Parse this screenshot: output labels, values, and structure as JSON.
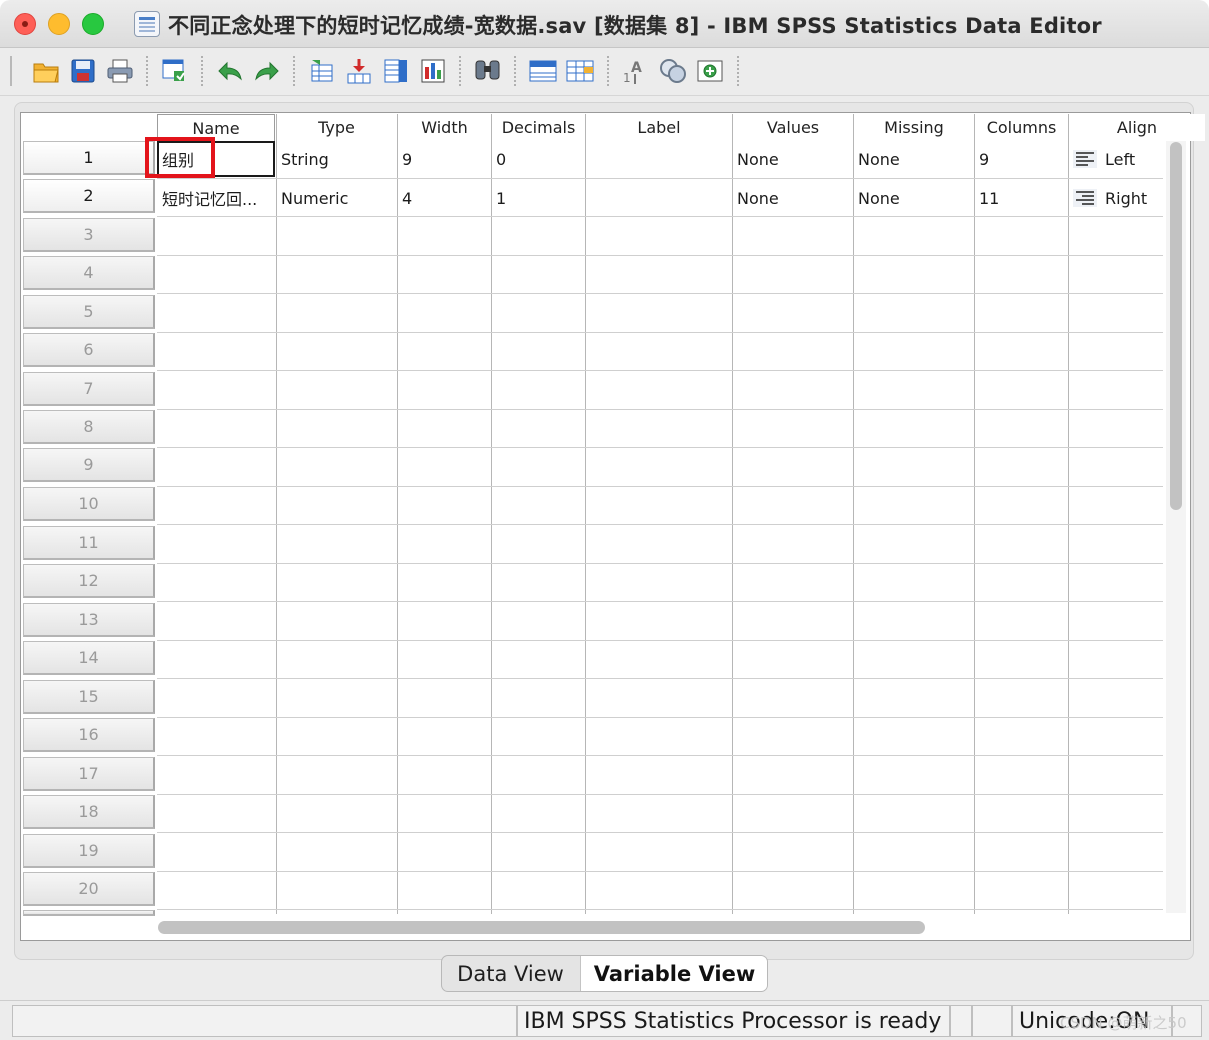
{
  "window": {
    "title": "不同正念处理下的短时记忆成绩-宽数据.sav [数据集 8] - IBM SPSS Statistics Data Editor"
  },
  "toolbar": {
    "buttons": [
      "open-icon",
      "save-icon",
      "print-icon",
      "dialog-recall-icon",
      "undo-icon",
      "redo-icon",
      "goto-case-icon",
      "goto-variable-icon",
      "variables-icon",
      "run-descriptives-icon",
      "find-icon",
      "insert-cases-icon",
      "insert-variable-icon",
      "value-labels-icon",
      "use-variable-sets-icon",
      "add-ons-icon"
    ]
  },
  "grid": {
    "columns": [
      "Name",
      "Type",
      "Width",
      "Decimals",
      "Label",
      "Values",
      "Missing",
      "Columns",
      "Align"
    ],
    "rows": [
      {
        "num": "1",
        "name": "组别",
        "type": "String",
        "width": "9",
        "decimals": "0",
        "label": "",
        "values": "None",
        "missing": "None",
        "columns": "9",
        "align": "Left"
      },
      {
        "num": "2",
        "name": "短时记忆回...",
        "type": "Numeric",
        "width": "4",
        "decimals": "1",
        "label": "",
        "values": "None",
        "missing": "None",
        "columns": "11",
        "align": "Right"
      }
    ],
    "empty_rows": [
      "3",
      "4",
      "5",
      "6",
      "7",
      "8",
      "9",
      "10",
      "11",
      "12",
      "13",
      "14",
      "15",
      "16",
      "17",
      "18",
      "19",
      "20"
    ]
  },
  "tabs": {
    "data_view": "Data View",
    "variable_view": "Variable View",
    "active": "Variable View"
  },
  "status": {
    "processor": "IBM SPSS Statistics Processor is ready",
    "unicode": "Unicode:ON"
  },
  "watermark": "CSDN @萌新之50",
  "colors": {
    "highlight_box": "#e3141b",
    "toolbar_accent": "#2f7fd8"
  }
}
